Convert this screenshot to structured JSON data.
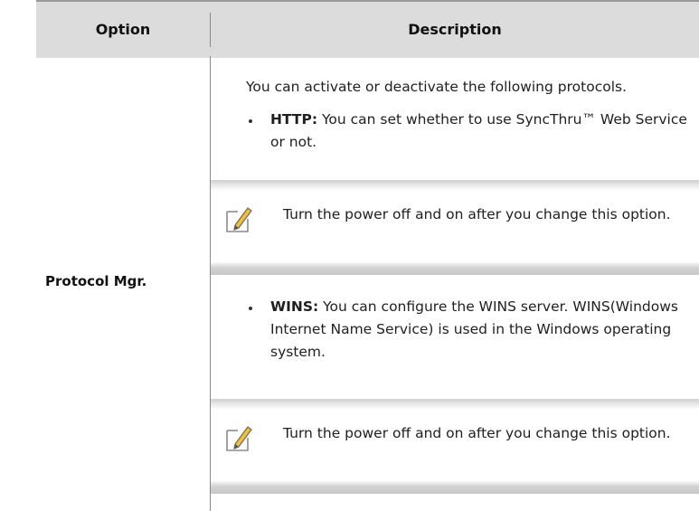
{
  "table": {
    "headers": {
      "option": "Option",
      "description": "Description"
    },
    "rows": [
      {
        "option": "Protocol Mgr.",
        "intro": "You can activate or deactivate the following protocols.",
        "items": [
          {
            "label": "HTTP:",
            "text": " You can set whether to use SyncThru™ Web Service or not.",
            "note": "Turn the power off and on after you change this option."
          },
          {
            "label": "WINS:",
            "text": "  You can configure the WINS server. WINS(Windows Internet Name Service) is used in the Windows operating system.",
            "note": "Turn the power off and on after you change this option."
          }
        ]
      }
    ]
  },
  "icons": {
    "note": "note-pencil-icon"
  },
  "colors": {
    "header_bg": "#dcdcdc",
    "note_band": "#cfcfcf",
    "note_icon_accent": "#f2c12e"
  }
}
